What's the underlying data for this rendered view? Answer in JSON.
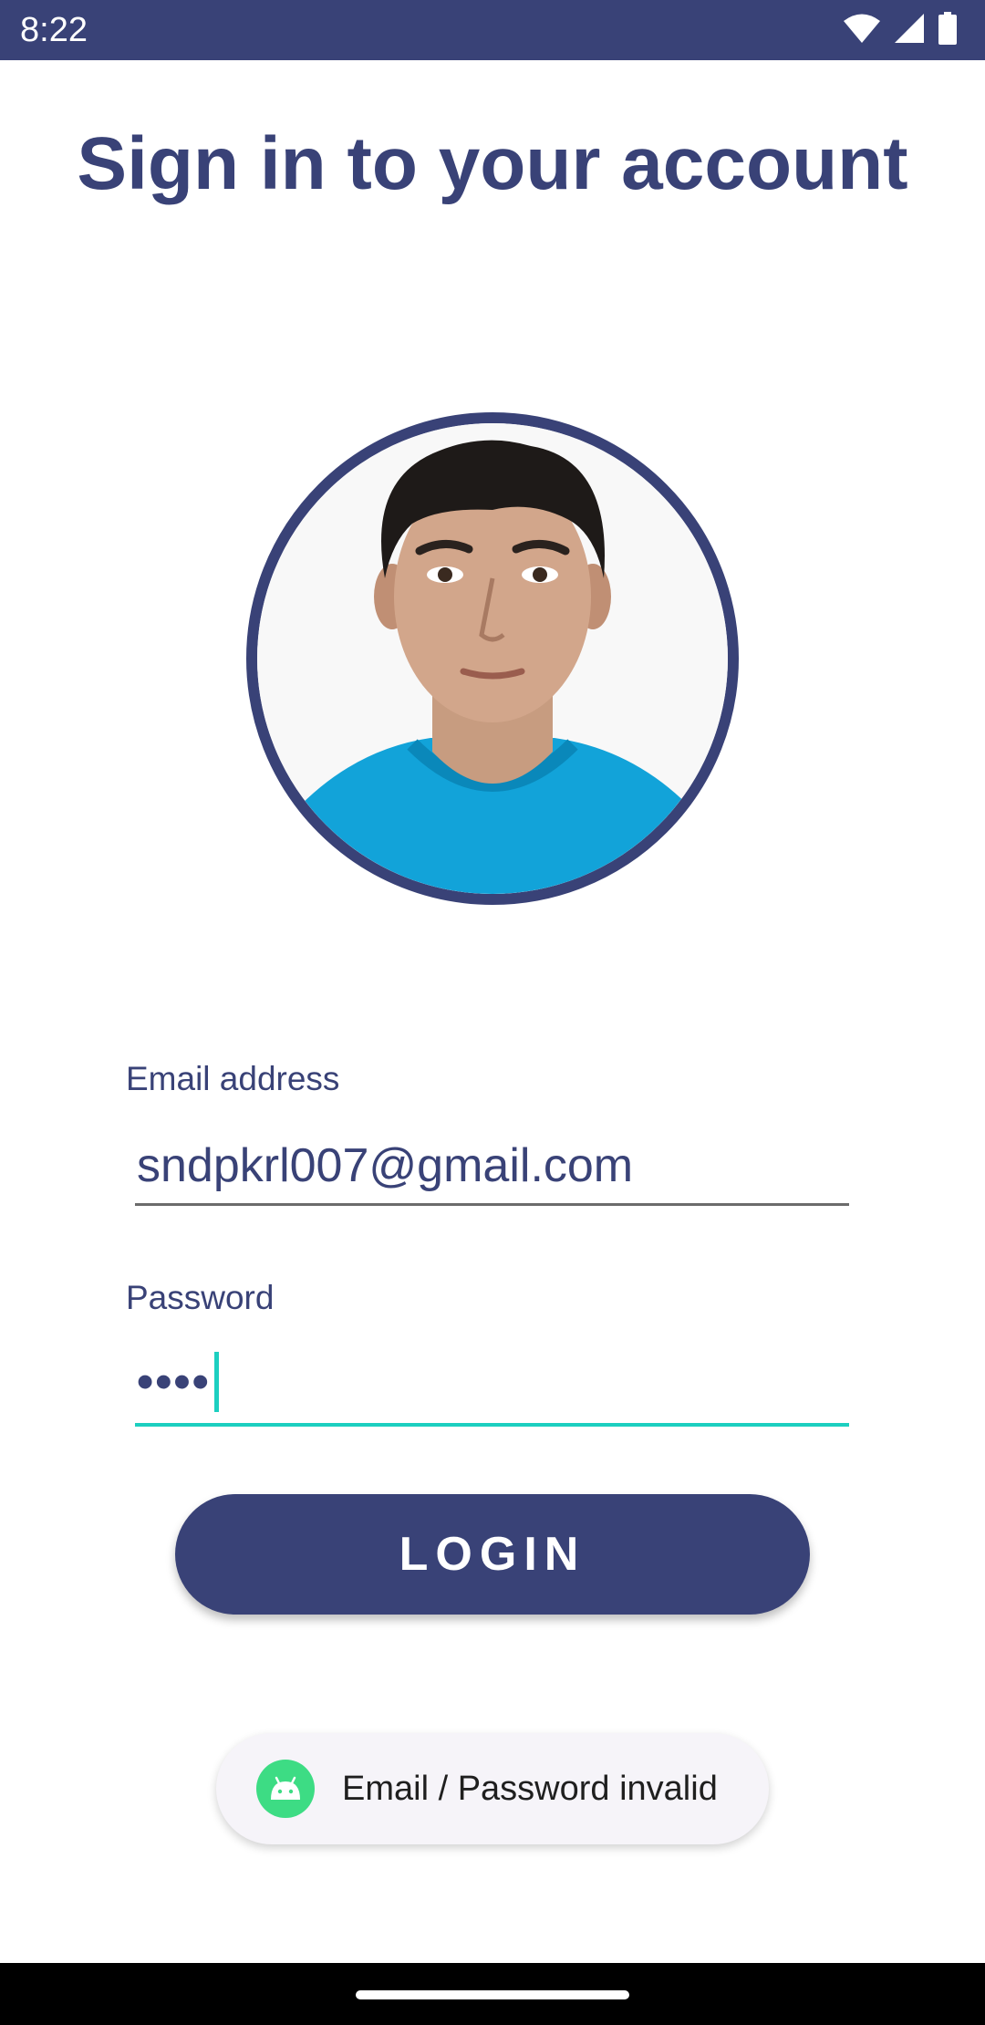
{
  "status_bar": {
    "time": "8:22",
    "icons": [
      "wifi-icon",
      "cell-signal-icon",
      "battery-icon"
    ],
    "background": "#394277"
  },
  "page": {
    "title": "Sign in to your account",
    "avatar_icon": "profile-photo",
    "accent_color": "#394277",
    "focus_color": "#1ccfc0"
  },
  "form": {
    "email_label": "Email address",
    "email_value": "sndpkrl007@gmail.com",
    "password_label": "Password",
    "password_value": "••••",
    "login_label": "LOGIN"
  },
  "toast": {
    "icon": "android-icon",
    "message": "Email / Password invalid"
  }
}
